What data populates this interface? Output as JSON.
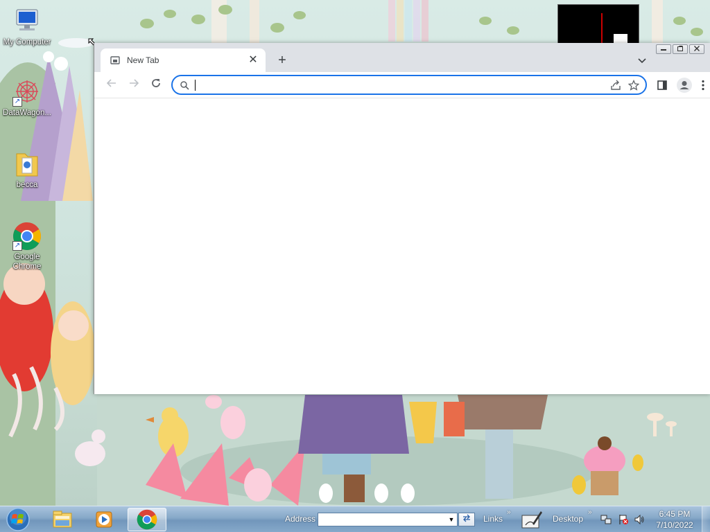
{
  "desktop": {
    "icons": [
      {
        "label": "My Computer",
        "icon": "computer-icon"
      },
      {
        "label": "DataWagon...",
        "icon": "datawagon-icon"
      },
      {
        "label": "becca",
        "icon": "folder-icon"
      },
      {
        "label": "Google Chrome",
        "icon": "chrome-icon"
      }
    ]
  },
  "chrome": {
    "tab": {
      "title": "New Tab",
      "close": "✕"
    },
    "new_tab": "+",
    "tab_search": "⌄",
    "window_controls": {
      "minimize": "—",
      "restore": "❐",
      "close": "✕"
    },
    "nav": {
      "back": "←",
      "forward": "→",
      "reload": "↻"
    },
    "omnibox": {
      "value": "",
      "placeholder": ""
    },
    "accent": "#1a73e8"
  },
  "taskbar": {
    "address_label": "Address",
    "address_value": "",
    "links_label": "Links",
    "desktop_label": "Desktop",
    "chevron": "»",
    "clock": {
      "time": "6:45 PM",
      "date": "7/10/2022"
    },
    "apps": [
      {
        "name": "explorer",
        "icon": "file-explorer-icon"
      },
      {
        "name": "media-player",
        "icon": "media-player-icon"
      },
      {
        "name": "chrome",
        "icon": "chrome-icon",
        "active": true
      }
    ]
  }
}
